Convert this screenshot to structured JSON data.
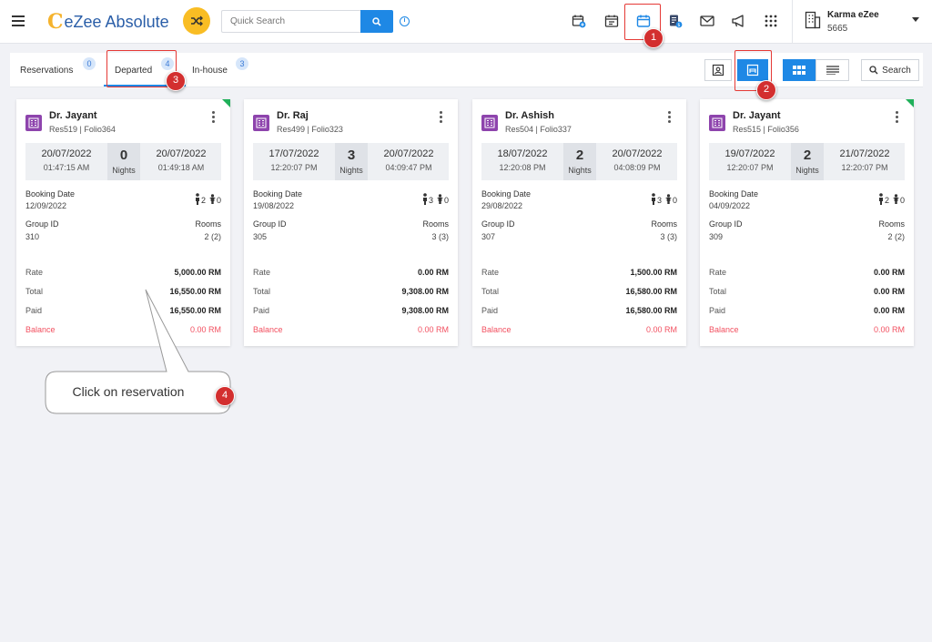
{
  "app": {
    "brand_mark": "C",
    "brand_name": "eZee Absolute",
    "search_placeholder": "Quick Search",
    "info_glyph": "i",
    "toolbar_icons": [
      "calendar-plus-icon",
      "calendar-check-icon",
      "calendar-icon",
      "folio-payment-icon",
      "mail-icon",
      "megaphone-icon",
      "apps-grid-icon"
    ],
    "user": {
      "name": "Karma eZee",
      "id": "5665"
    },
    "accent_color": "#1e88e5",
    "highlight_color": "#e53935"
  },
  "tabs": [
    {
      "label": "Reservations",
      "count": "0"
    },
    {
      "label": "Departed",
      "count": "4"
    },
    {
      "label": "In-house",
      "count": "3"
    }
  ],
  "actions": {
    "search_label": "Search"
  },
  "labels": {
    "nights": "Nights",
    "booking_date": "Booking Date",
    "group_id": "Group ID",
    "rooms": "Rooms",
    "rate": "Rate",
    "total": "Total",
    "paid": "Paid",
    "balance": "Balance"
  },
  "cards": [
    {
      "name": "Dr. Jayant",
      "res": "Res519 | Folio364",
      "arrival_date": "20/07/2022",
      "arrival_time": "01:47:15 AM",
      "nights": "0",
      "departure_date": "20/07/2022",
      "departure_time": "01:49:18 AM",
      "booking_date": "12/09/2022",
      "adults": "2",
      "children": "0",
      "group_id": "310",
      "rooms": "2 (2)",
      "rate": "5,000.00 RM",
      "total": "16,550.00 RM",
      "paid": "16,550.00 RM",
      "balance": "0.00 RM"
    },
    {
      "name": "Dr. Raj",
      "res": "Res499 | Folio323",
      "arrival_date": "17/07/2022",
      "arrival_time": "12:20:07 PM",
      "nights": "3",
      "departure_date": "20/07/2022",
      "departure_time": "04:09:47 PM",
      "booking_date": "19/08/2022",
      "adults": "3",
      "children": "0",
      "group_id": "305",
      "rooms": "3 (3)",
      "rate": "0.00 RM",
      "total": "9,308.00 RM",
      "paid": "9,308.00 RM",
      "balance": "0.00 RM"
    },
    {
      "name": "Dr. Ashish",
      "res": "Res504 | Folio337",
      "arrival_date": "18/07/2022",
      "arrival_time": "12:20:08 PM",
      "nights": "2",
      "departure_date": "20/07/2022",
      "departure_time": "04:08:09 PM",
      "booking_date": "29/08/2022",
      "adults": "3",
      "children": "0",
      "group_id": "307",
      "rooms": "3 (3)",
      "rate": "1,500.00 RM",
      "total": "16,580.00 RM",
      "paid": "16,580.00 RM",
      "balance": "0.00 RM"
    },
    {
      "name": "Dr. Jayant",
      "res": "Res515 | Folio356",
      "arrival_date": "19/07/2022",
      "arrival_time": "12:20:07 PM",
      "nights": "2",
      "departure_date": "21/07/2022",
      "departure_time": "12:20:07 PM",
      "booking_date": "04/09/2022",
      "adults": "2",
      "children": "0",
      "group_id": "309",
      "rooms": "2 (2)",
      "rate": "0.00 RM",
      "total": "0.00 RM",
      "paid": "0.00 RM",
      "balance": "0.00 RM"
    }
  ],
  "annotations": {
    "markers": [
      "1",
      "2",
      "3",
      "4"
    ],
    "callout": "Click on reservation"
  }
}
